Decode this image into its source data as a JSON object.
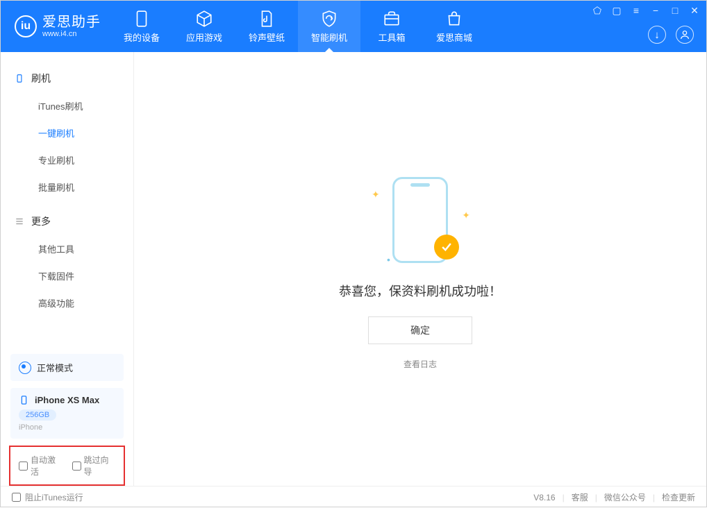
{
  "app": {
    "name": "爱思助手",
    "site": "www.i4.cn"
  },
  "nav": {
    "device": "我的设备",
    "apps": "应用游戏",
    "ring": "铃声壁纸",
    "flash": "智能刷机",
    "toolbox": "工具箱",
    "store": "爱思商城"
  },
  "sidebar": {
    "flash_header": "刷机",
    "itunes_flash": "iTunes刷机",
    "oneclick_flash": "一键刷机",
    "pro_flash": "专业刷机",
    "batch_flash": "批量刷机",
    "more_header": "更多",
    "other_tools": "其他工具",
    "download_fw": "下载固件",
    "advanced": "高级功能"
  },
  "mode": {
    "label": "正常模式"
  },
  "device": {
    "model": "iPhone XS Max",
    "storage": "256GB",
    "type": "iPhone"
  },
  "options": {
    "auto_activate": "自动激活",
    "skip_guide": "跳过向导"
  },
  "main": {
    "success": "恭喜您，保资料刷机成功啦！",
    "confirm": "确定",
    "view_log": "查看日志"
  },
  "footer": {
    "block_itunes": "阻止iTunes运行",
    "version": "V8.16",
    "cs": "客服",
    "wechat": "微信公众号",
    "update": "检查更新"
  }
}
